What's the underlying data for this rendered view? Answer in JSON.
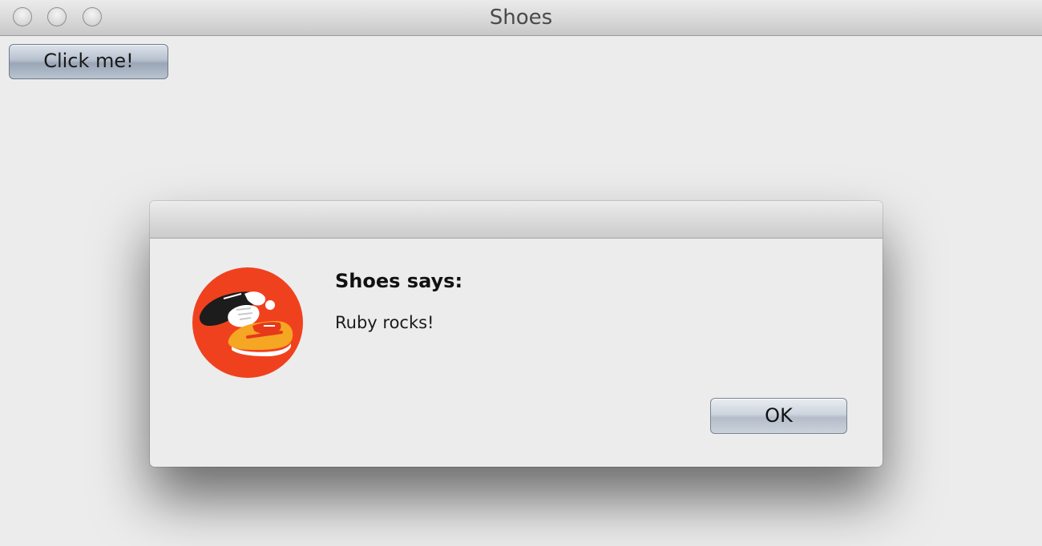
{
  "window": {
    "title": "Shoes"
  },
  "main": {
    "click_button_label": "Click me!"
  },
  "dialog": {
    "heading": "Shoes says:",
    "message": "Ruby rocks!",
    "ok_label": "OK",
    "icon": "shoes-logo-icon"
  },
  "colors": {
    "window_background": "#ececec",
    "logo_red": "#f0411e",
    "logo_orange": "#f5a623"
  }
}
